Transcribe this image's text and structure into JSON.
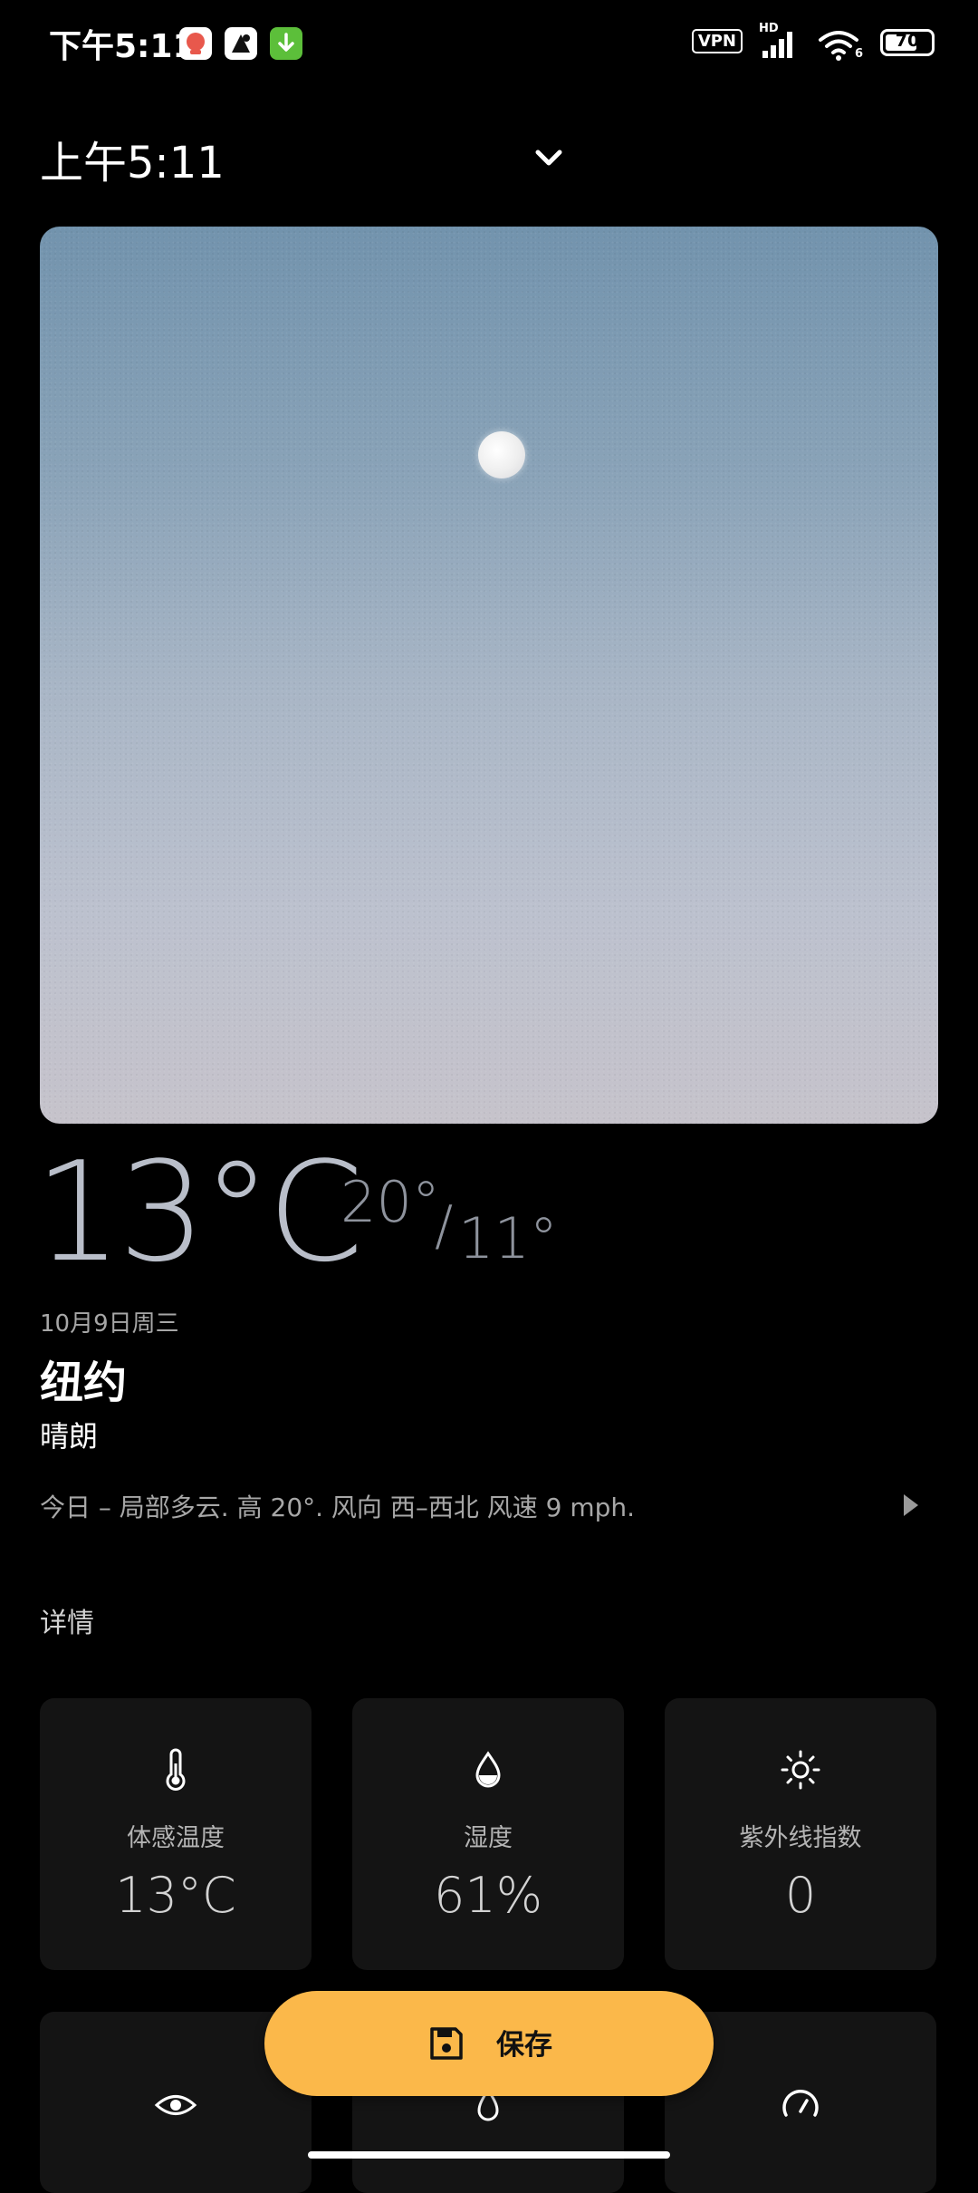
{
  "status_bar": {
    "time": "下午5:11",
    "vpn": "VPN",
    "network": "HD",
    "wifi_badge": "6",
    "battery_level": "70",
    "battery_fraction": 0.7
  },
  "header": {
    "time": "上午5:11",
    "expand_icon": "chevron-down-icon"
  },
  "weather": {
    "temperature": "13°C",
    "high": "20°",
    "separator": "/",
    "low": "11°",
    "date": "10月9日周三",
    "city": "纽约",
    "condition": "晴朗",
    "forecast": "今日 – 局部多云. 高 20°. 风向 西–西北 风速 9 mph."
  },
  "details": {
    "heading": "详情",
    "cards": [
      {
        "label": "体感温度",
        "value": "13°C",
        "icon": "thermometer-icon"
      },
      {
        "label": "湿度",
        "value": "61%",
        "icon": "humidity-icon"
      },
      {
        "label": "紫外线指数",
        "value": "0",
        "icon": "sun-icon"
      },
      {
        "label": "",
        "value": "",
        "icon": "eye-icon"
      },
      {
        "label": "",
        "value": "",
        "icon": "droplet-icon"
      },
      {
        "label": "",
        "value": "",
        "icon": "gauge-icon"
      }
    ]
  },
  "actions": {
    "save_label": "保存"
  },
  "colors": {
    "accent": "#fbb84a",
    "background": "#000000",
    "card": "#141414"
  }
}
